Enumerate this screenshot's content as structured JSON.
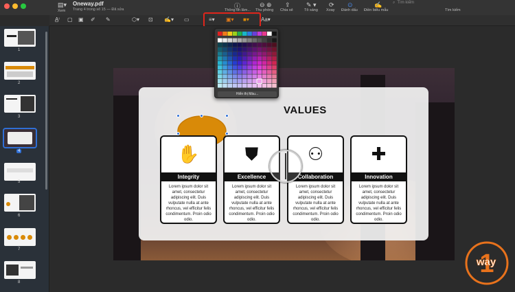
{
  "window": {
    "title": "Oneway.pdf",
    "subtitle": "Trang 4 trong số 15 — Đã sửa",
    "view_label": "Xem"
  },
  "toolbar": {
    "items": [
      {
        "label": "Thông tin lâm...",
        "icon": "info-icon"
      },
      {
        "label": "Thu phóng",
        "icon": "zoom-icon"
      },
      {
        "label": "Chia sẻ",
        "icon": "share-icon"
      },
      {
        "label": "Tô sáng",
        "icon": "highlight-icon"
      },
      {
        "label": "Xoay",
        "icon": "rotate-icon"
      },
      {
        "label": "Đánh dấu",
        "icon": "markup-icon"
      },
      {
        "label": "Điền biểu mẫu",
        "icon": "form-icon"
      }
    ],
    "search_placeholder": "Tìm kiếm",
    "search_label": "Tìm kiếm"
  },
  "color_popover": {
    "more_colors_label": "Hiển thị Màu..."
  },
  "markup": {
    "text_style_label": "Aa"
  },
  "sidebar": {
    "pages": [
      {
        "number": "1"
      },
      {
        "number": "2"
      },
      {
        "number": "3"
      },
      {
        "number": "4",
        "selected": true
      },
      {
        "number": "5"
      },
      {
        "number": "6"
      },
      {
        "number": "7"
      },
      {
        "number": "8"
      }
    ]
  },
  "slide": {
    "title": "VALUES",
    "cards": [
      {
        "title": "Integrity",
        "icon": "handshake-icon",
        "body": "Lorem ipsum dolor sit amet, consectetur adipiscing elit. Duis vulputate nulla at ante rhoncus, vel efficitur felis condimentum. Proin odio odio."
      },
      {
        "title": "Excellence",
        "icon": "shield-check-icon",
        "body": "Lorem ipsum dolor sit amet, consectetur adipiscing elit. Duis vulputate nulla at ante rhoncus, vel efficitur felis condimentum. Proin odio odio."
      },
      {
        "title": "Collaboration",
        "icon": "meeting-icon",
        "body": "Lorem ipsum dolor sit amet, consectetur adipiscing elit. Duis vulputate nulla at ante rhoncus, vel efficitur felis condimentum. Proin odio odio."
      },
      {
        "title": "Innovation",
        "icon": "puzzle-icon",
        "body": "Lorem ipsum dolor sit amet, consectetur adipiscing elit. Duis vulputate nulla at ante rhoncus, vel efficitur felis condimentum. Proin odio odio."
      }
    ],
    "bubble_color": "#d98a08"
  },
  "logo": {
    "text": "way",
    "digit": "1",
    "color": "#e8721c"
  }
}
